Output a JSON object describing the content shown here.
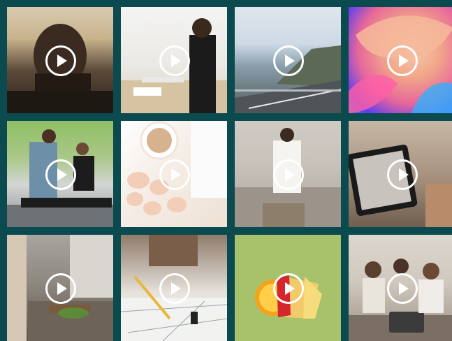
{
  "colors": {
    "background": "#0b4a4f",
    "play_ring": "#ffffff"
  },
  "tiles": [
    {
      "icon": "play-icon"
    },
    {
      "icon": "play-icon"
    },
    {
      "icon": "play-icon"
    },
    {
      "icon": "play-icon"
    },
    {
      "icon": "play-icon"
    },
    {
      "icon": "play-icon"
    },
    {
      "icon": "play-icon"
    },
    {
      "icon": "play-icon"
    },
    {
      "icon": "play-icon"
    },
    {
      "icon": "play-icon"
    },
    {
      "icon": "play-icon"
    },
    {
      "icon": "play-icon"
    }
  ]
}
